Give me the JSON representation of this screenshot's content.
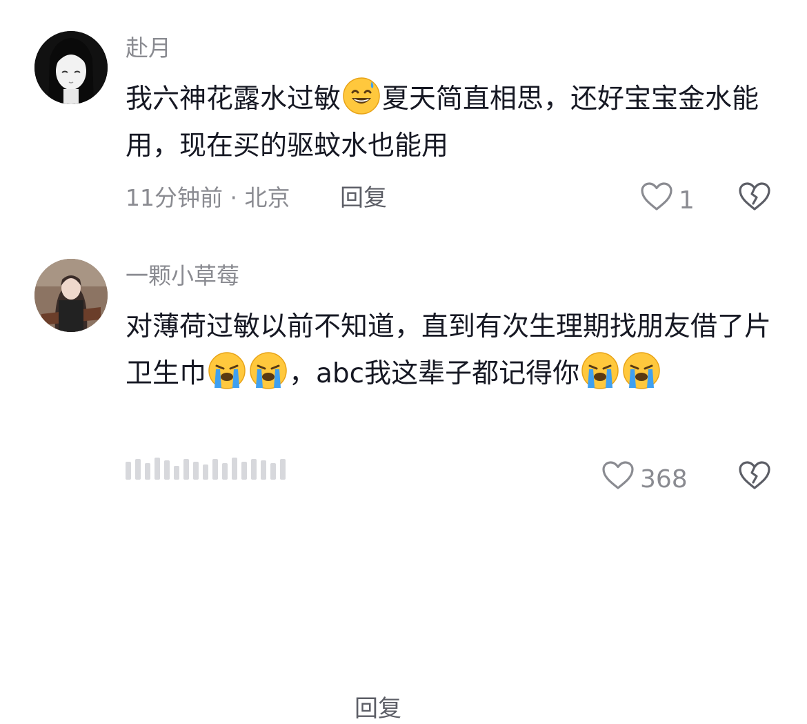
{
  "comments": [
    {
      "username": "赴月",
      "text_segments": [
        "我六神花露水过敏",
        "夏天简直相思，还好宝宝金水能用，现在买的驱蚊水也能用"
      ],
      "emojis": [
        "smile-sweat-emoji"
      ],
      "time": "11分钟前 · 北京",
      "reply_label": "回复",
      "like_count": "1"
    },
    {
      "username": "一颗小草莓",
      "text_segments": [
        "对薄荷过敏以前不知道，直到有次生理期找朋友借了片卫生巾",
        "，abc我这辈子都记得你"
      ],
      "emojis": [
        "loudly-crying-emoji",
        "loudly-crying-emoji",
        "loudly-crying-emoji",
        "loudly-crying-emoji"
      ],
      "reply_label": "回复",
      "like_count": "368"
    }
  ],
  "icons": {
    "like": "heart-outline-icon",
    "dislike": "broken-heart-icon"
  },
  "colors": {
    "text_primary": "#161823",
    "text_secondary": "#8a8b91",
    "emoji_yellow": "#ffc83d",
    "tear_blue": "#3fa0f0"
  }
}
